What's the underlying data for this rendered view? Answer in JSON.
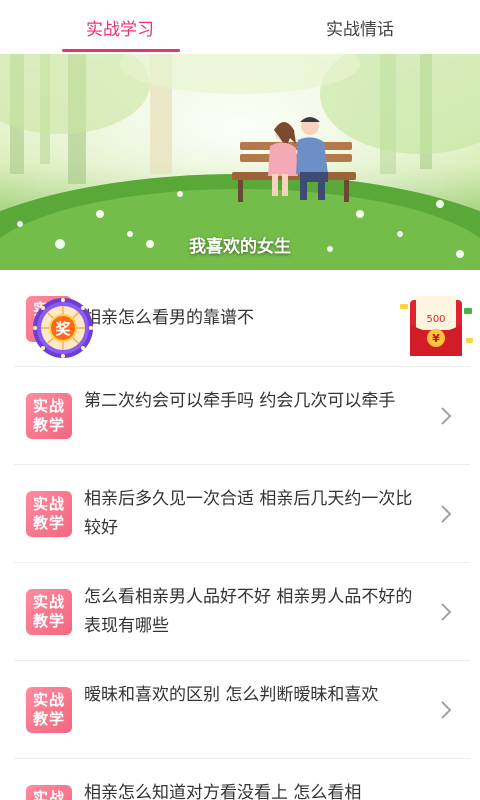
{
  "tabs": {
    "learn": "实战学习",
    "chat": "实战情话"
  },
  "banner": {
    "title": "我喜欢的女生"
  },
  "badge": {
    "line1": "实战",
    "line2": "教学"
  },
  "wheel": {
    "label": "奖"
  },
  "red_packet": {
    "amount": "500",
    "currency": "¥"
  },
  "items": [
    {
      "title": "相亲怎么看男的靠谱不"
    },
    {
      "title": "第二次约会可以牵手吗 约会几次可以牵手"
    },
    {
      "title": "相亲后多久见一次合适 相亲后几天约一次比较好"
    },
    {
      "title": "怎么看相亲男人品好不好 相亲男人品不好的表现有哪些"
    },
    {
      "title": "暧昧和喜欢的区别 怎么判断暧昧和喜欢"
    },
    {
      "title": "相亲怎么知道对方看没看上 怎么看相"
    }
  ],
  "colors": {
    "accent": "#e8336e",
    "badge": "#f2677e"
  }
}
